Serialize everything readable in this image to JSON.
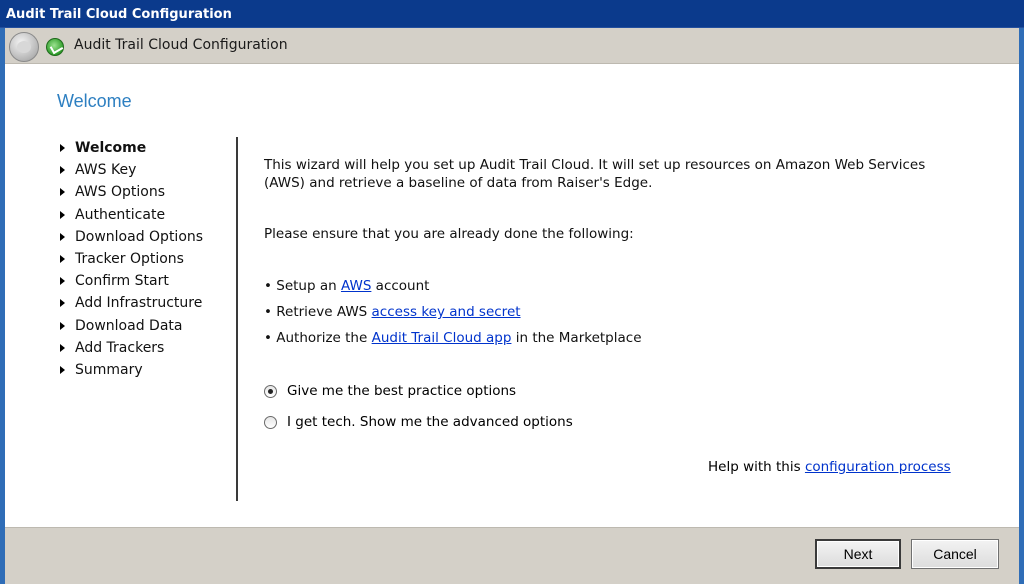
{
  "window": {
    "title": "Audit Trail Cloud Configuration"
  },
  "nav": {
    "title": "Audit Trail Cloud Configuration"
  },
  "page": {
    "title": "Welcome"
  },
  "steps": [
    {
      "label": "Welcome",
      "active": true
    },
    {
      "label": "AWS Key"
    },
    {
      "label": "AWS Options"
    },
    {
      "label": "Authenticate"
    },
    {
      "label": "Download Options"
    },
    {
      "label": "Tracker Options"
    },
    {
      "label": "Confirm Start"
    },
    {
      "label": "Add Infrastructure"
    },
    {
      "label": "Download Data"
    },
    {
      "label": "Add Trackers"
    },
    {
      "label": "Summary"
    }
  ],
  "content": {
    "intro": "This wizard will help you set up Audit Trail  Cloud. It will set up resources on Amazon Web Services (AWS) and retrieve a baseline of data from Raiser's Edge.",
    "ensure": "Please ensure that you are already done the following:",
    "bullets": [
      {
        "pre": "• Setup an ",
        "link": "AWS",
        "post": " account"
      },
      {
        "pre": "• Retrieve AWS ",
        "link": "access key and secret",
        "post": ""
      },
      {
        "pre": "• Authorize the ",
        "link": "Audit Trail Cloud app",
        "post": " in the Marketplace"
      }
    ],
    "options": [
      {
        "label": "Give me the best practice options",
        "checked": true
      },
      {
        "label": "I get tech. Show me the advanced options",
        "checked": false
      }
    ],
    "help": {
      "pre": "Help with this ",
      "link": "configuration process"
    }
  },
  "buttons": {
    "next": "Next",
    "cancel": "Cancel"
  },
  "colors": {
    "titlebar": "#0b3a8c",
    "heading": "#2d7fc1",
    "link": "#0033cc",
    "chrome": "#d4d0c8"
  }
}
